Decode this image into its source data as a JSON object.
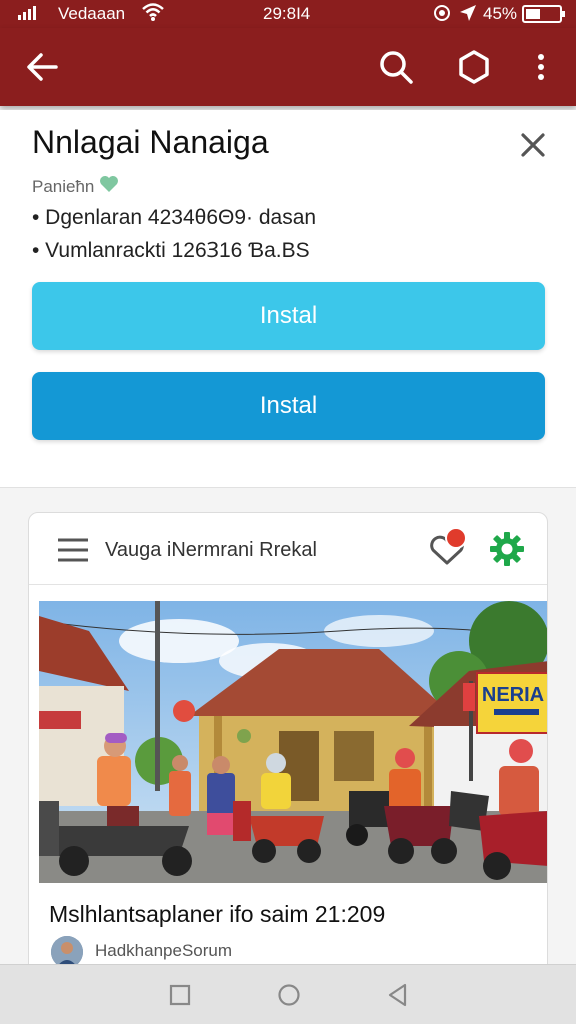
{
  "status_bar": {
    "carrier": "Vedaaan",
    "time": "29:8Ι4",
    "battery_text": "45%",
    "battery_level": 0.45
  },
  "app_bar": {
    "icons": [
      "back-arrow-icon",
      "search-icon",
      "hexagon-icon",
      "more-vert-icon"
    ],
    "color": "#8b1e1e"
  },
  "app_card": {
    "title": "Nnlagai Nanaiga",
    "subtitle": "Panieħn",
    "subtitle_icon": "heart-icon",
    "bullets": [
      "• Dgenlaran 4234θ6Θ9· dasan",
      "• Vumlanrackti 126Ɜ16 Ɓa.BS"
    ],
    "install_primary": "Instal",
    "install_secondary": "Instal",
    "colors": {
      "install_primary": "#3cc7ea",
      "install_secondary": "#1498d5"
    }
  },
  "post": {
    "header_title": "Vauga iNermrani Rrekal",
    "notification_badge": true,
    "photo_sign_text": "NERIA",
    "caption": "Mslhlantsaplaner ifo saim 21:209",
    "author": "HadkhanpeSorum",
    "accent_color": "#1fa84a"
  },
  "nav_bar": {
    "icons": [
      "recents-square-icon",
      "home-circle-icon",
      "back-triangle-icon"
    ]
  }
}
